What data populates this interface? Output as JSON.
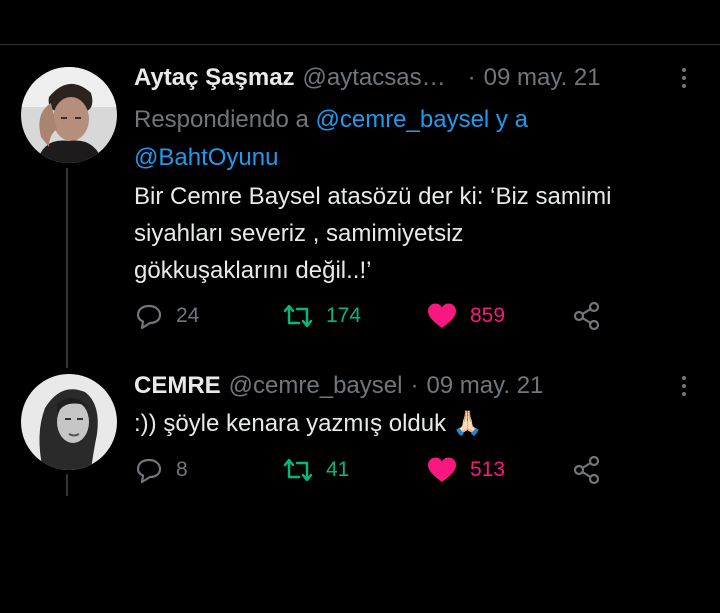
{
  "colors": {
    "background": "#000000",
    "text": "#e7e9ea",
    "muted": "#71767b",
    "link": "#1d9bf0",
    "retweet": "#00ba7c",
    "like": "#f91880"
  },
  "tweets": [
    {
      "name": "Aytaç Şaşmaz",
      "handle": "@aytacsas…",
      "separator": "·",
      "date": "09 may. 21",
      "reply_prefix": "Respondiendo a",
      "reply_mention_1": "@cemre_baysel",
      "reply_conj": "y a",
      "reply_mention_2": "@BahtOyunu",
      "text_lines": [
        "Bir Cemre Baysel atasözü der ki: ‘Biz samimi",
        "siyahları severiz , samimiyetsiz",
        "gökkuşaklarını değil..!’"
      ],
      "replies": "24",
      "retweets": "174",
      "likes": "859",
      "icons": [
        "reply-icon",
        "retweet-icon",
        "heart-icon",
        "share-icon",
        "more-icon"
      ]
    },
    {
      "name": "CEMRE",
      "handle": "@cemre_baysel",
      "separator": "·",
      "date": "09 may. 21",
      "text": ":)) şöyle kenara yazmış olduk",
      "emoji": "🙏🏻",
      "replies": "8",
      "retweets": "41",
      "likes": "513",
      "icons": [
        "reply-icon",
        "retweet-icon",
        "heart-icon",
        "share-icon",
        "more-icon"
      ]
    }
  ]
}
